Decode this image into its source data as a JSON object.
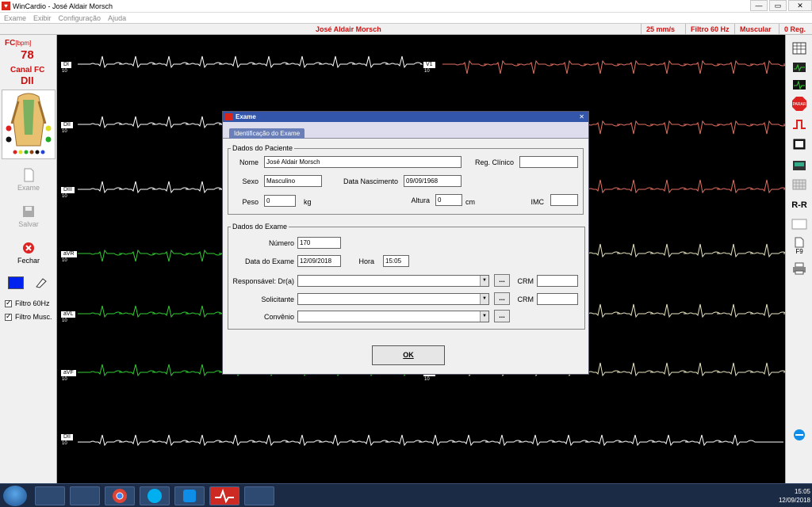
{
  "window": {
    "title": "WinCardio - José Aldair Morsch"
  },
  "menu": [
    "Exame",
    "Exibir",
    "Configuração",
    "Ajuda"
  ],
  "status": {
    "patient": "José Aldair Morsch",
    "speed": "25 mm/s",
    "filter": "Filtro 60 Hz",
    "muscular": "Muscular",
    "reg": "0 Reg."
  },
  "left_panel": {
    "fc_label": "FC",
    "fc_unit": "[bpm]",
    "fc_value": "78",
    "canal_label": "Canal FC",
    "canal_value": "DII",
    "buttons": {
      "exame": "Exame",
      "salvar": "Salvar",
      "fechar": "Fechar"
    },
    "filters": [
      {
        "label": "Filtro 60Hz",
        "checked": true
      },
      {
        "label": "Filtro Musc.",
        "checked": true
      }
    ]
  },
  "ecg": {
    "scale_text": "10",
    "left_leads": [
      "DI",
      "DII",
      "DIII",
      "aVR",
      "aVL",
      "aVF"
    ],
    "right_leads": [
      "V1",
      "V6"
    ],
    "bottom_lead": "DII"
  },
  "dialog": {
    "title": "Exame",
    "tab": "Identificação do Exame",
    "patient_group": "Dados do Paciente",
    "exam_group": "Dados do Exame",
    "fields": {
      "nome_label": "Nome",
      "nome_value": "José Aldair Morsch",
      "reg_label": "Reg. Clínico",
      "reg_value": "",
      "sexo_label": "Sexo",
      "sexo_value": "Masculino",
      "nasc_label": "Data Nascimento",
      "nasc_value": "09/09/1968",
      "peso_label": "Peso",
      "peso_value": "0",
      "peso_unit": "kg",
      "altura_label": "Altura",
      "altura_value": "0",
      "altura_unit": "cm",
      "imc_label": "IMC",
      "imc_value": "",
      "numero_label": "Número",
      "numero_value": "170",
      "data_label": "Data do Exame",
      "data_value": "12/09/2018",
      "hora_label": "Hora",
      "hora_value": "15:05",
      "resp_label": "Responsável: Dr(a)",
      "resp_value": "",
      "crm_label": "CRM",
      "crm1_value": "",
      "solic_label": "Solicitante",
      "solic_value": "",
      "crm2_value": "",
      "conv_label": "Convênio",
      "conv_value": "",
      "dots": "...",
      "ok": "OK"
    }
  },
  "right_panel": {
    "rr": "R-R",
    "f9": "F9",
    "parar": "PARAR"
  },
  "taskbar": {
    "time": "15:05",
    "date": "12/09/2018"
  },
  "colors": {
    "accent": "#cc1111",
    "ecg_white": "#ffffff",
    "ecg_green": "#33cc33",
    "ecg_salmon": "#e07060",
    "ecg_cream": "#e8e4c0",
    "dialog_title": "#3355aa"
  }
}
